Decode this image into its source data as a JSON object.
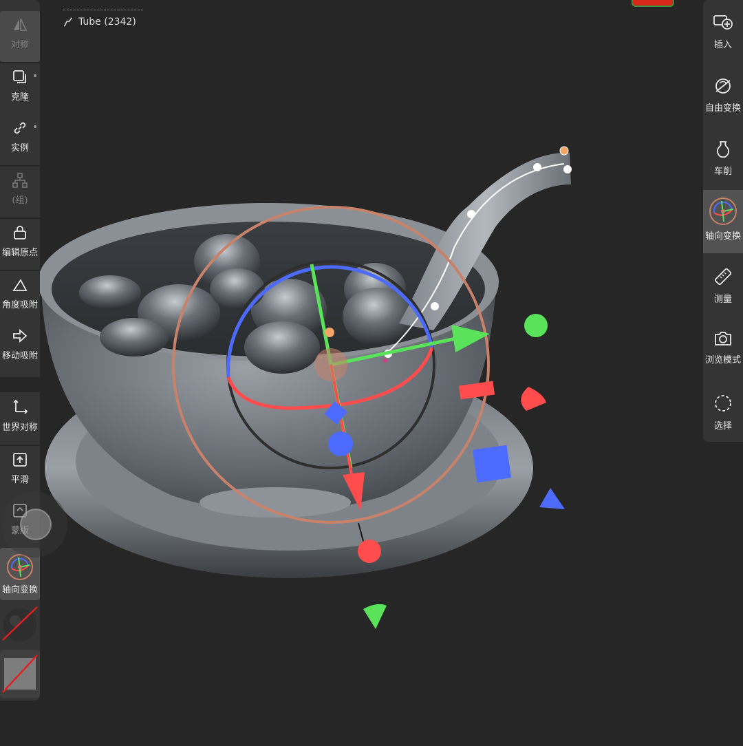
{
  "scene": {
    "object_label": "Tube (2342)",
    "object_icon": "curve-icon"
  },
  "left_toolbar": {
    "items": [
      {
        "label": "对称",
        "icon": "symmetry-icon",
        "state": "disabled"
      },
      {
        "label": "克隆",
        "icon": "clone-icon"
      },
      {
        "label": "实例",
        "icon": "link-icon"
      },
      {
        "label": "(组)",
        "icon": "group-icon",
        "state": "disabled"
      },
      {
        "label": "编辑原点",
        "icon": "lock-icon"
      },
      {
        "label": "角度吸附",
        "icon": "angle-icon"
      },
      {
        "label": "移动吸附",
        "icon": "arrow-right-icon"
      },
      {
        "label": "世界对称",
        "icon": "axes-icon"
      },
      {
        "label": "平滑",
        "icon": "smooth-icon"
      },
      {
        "label": "蒙版",
        "icon": "mask-icon"
      },
      {
        "label": "轴向变换",
        "icon": "gizmo-icon",
        "state": "active"
      }
    ]
  },
  "right_toolbar": {
    "items": [
      {
        "label": "插入",
        "icon": "insert-icon"
      },
      {
        "label": "自由变换",
        "icon": "free-transform-icon"
      },
      {
        "label": "车削",
        "icon": "lathe-vase-icon"
      },
      {
        "label": "轴向变换",
        "icon": "gizmo-icon",
        "state": "active"
      },
      {
        "label": "测量",
        "icon": "ruler-icon"
      },
      {
        "label": "浏览模式",
        "icon": "camera-icon"
      },
      {
        "label": "选择",
        "icon": "dashed-circle-icon"
      }
    ]
  },
  "colors": {
    "x_axis": "#ff4c4c",
    "y_axis": "#5ae35a",
    "z_axis": "#4d6cff",
    "outer_ring": "#c9826a",
    "active_bg": "#525252",
    "panel_bg": "#343434"
  }
}
